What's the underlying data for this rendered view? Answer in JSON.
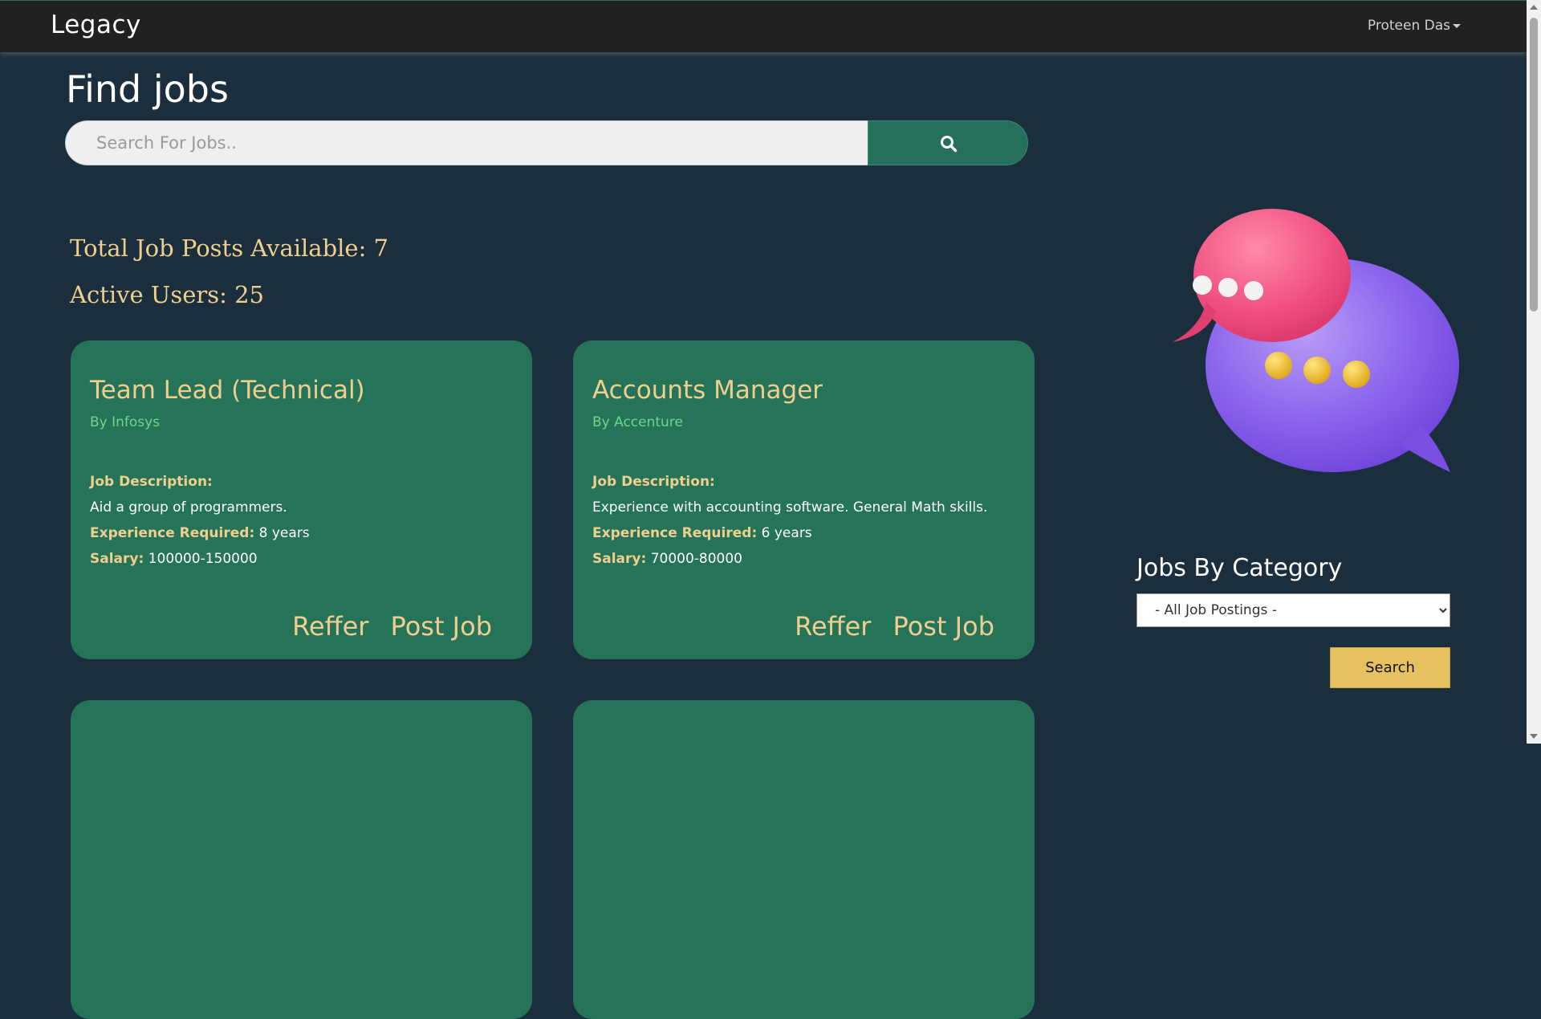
{
  "nav": {
    "brand": "Legacy",
    "user_name": "Proteen Das"
  },
  "page": {
    "title": "Find jobs"
  },
  "search": {
    "placeholder": "Search For Jobs..",
    "value": "",
    "button_icon": "search-icon"
  },
  "stats": {
    "total_jobs": "Total Job Posts Available: 7",
    "active_users": "Active Users: 25"
  },
  "labels": {
    "description": "Job Description:",
    "experience": "Experience Required:",
    "salary": "Salary:"
  },
  "jobs": [
    {
      "title": "Team Lead (Technical)",
      "company": "By Infosys",
      "description": "Aid a group of programmers.",
      "experience": "8 years",
      "salary": "100000-150000",
      "refer_label": "Reffer",
      "post_label": "Post Job"
    },
    {
      "title": "Accounts Manager",
      "company": "By Accenture",
      "description": "Experience with accounting software. General Math skills.",
      "experience": "6 years",
      "salary": "70000-80000",
      "refer_label": "Reffer",
      "post_label": "Post Job"
    }
  ],
  "sidebar": {
    "illustration": "chat-bubbles-illustration",
    "category_heading": "Jobs By Category",
    "category_selected": "- All Job Postings -",
    "search_button": "Search"
  },
  "colors": {
    "background": "#1a2e3d",
    "navbar": "#212121",
    "card": "#257358",
    "accent_gold": "#f0cf8e",
    "company_green": "#6fd68f",
    "button_gold": "#e6c15f"
  }
}
